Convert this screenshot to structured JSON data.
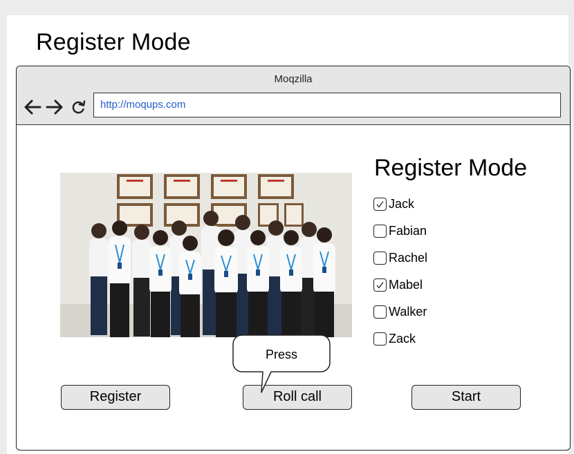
{
  "page": {
    "title": "Register Mode"
  },
  "browser": {
    "title": "Moqzilla",
    "url": "http://moqups.com",
    "back_icon": "arrow-left-icon",
    "forward_icon": "arrow-right-icon",
    "reload_icon": "reload-icon"
  },
  "panel": {
    "title": "Register Mode",
    "students": [
      {
        "name": "Jack",
        "checked": true
      },
      {
        "name": "Fabian",
        "checked": false
      },
      {
        "name": "Rachel",
        "checked": false
      },
      {
        "name": "Mabel",
        "checked": true
      },
      {
        "name": "Walker",
        "checked": false
      },
      {
        "name": "Zack",
        "checked": false
      }
    ]
  },
  "buttons": {
    "register": "Register",
    "roll_call": "Roll call",
    "start": "Start"
  },
  "callout": {
    "text": "Press"
  },
  "colors": {
    "url_text": "#1f5fc8",
    "button_fill": "#e6e6e6",
    "chrome_fill": "#e6e6e6"
  }
}
